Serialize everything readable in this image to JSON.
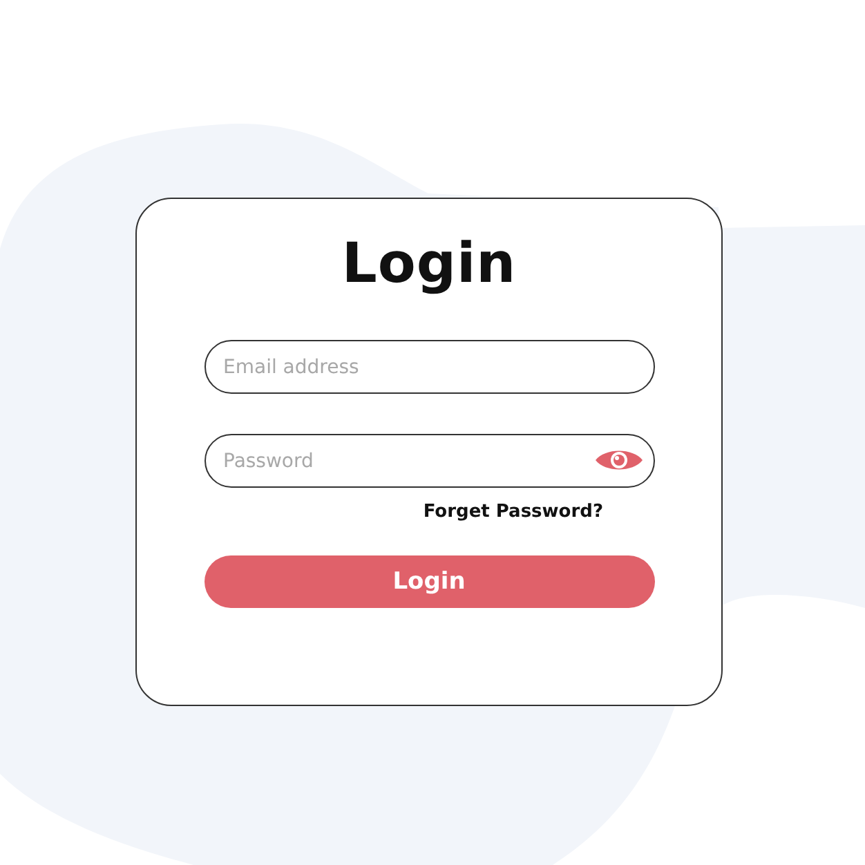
{
  "card": {
    "title": "Login",
    "fields": [
      {
        "kind": "email",
        "placeholder": "Email address"
      },
      {
        "kind": "password",
        "placeholder": "Password"
      }
    ],
    "forgot_link": "Forget Password?",
    "button": "Login"
  }
}
